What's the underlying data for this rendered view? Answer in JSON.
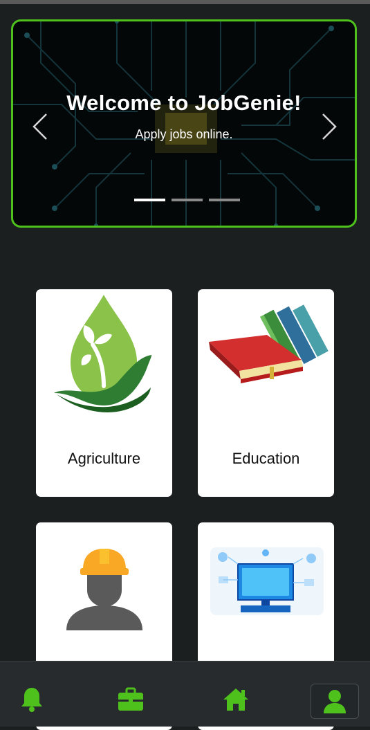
{
  "carousel": {
    "title": "Welcome to JobGenie!",
    "subtitle": "Apply jobs online.",
    "indicator_count": 3,
    "active_index": 0
  },
  "categories": [
    {
      "label": "Agriculture",
      "icon": "plant-hand-icon"
    },
    {
      "label": "Education",
      "icon": "books-icon"
    },
    {
      "label": "",
      "icon": "construction-worker-icon"
    },
    {
      "label": "",
      "icon": "technology-computer-icon"
    }
  ],
  "bottom_nav": [
    {
      "icon": "bell-icon"
    },
    {
      "icon": "briefcase-icon"
    },
    {
      "icon": "home-icon"
    },
    {
      "icon": "user-profile-icon",
      "selected": true
    }
  ],
  "colors": {
    "accent_green": "#4fc11d",
    "background": "#1b1f1f",
    "nav_background": "#272b2d",
    "card_background": "#ffffff"
  }
}
